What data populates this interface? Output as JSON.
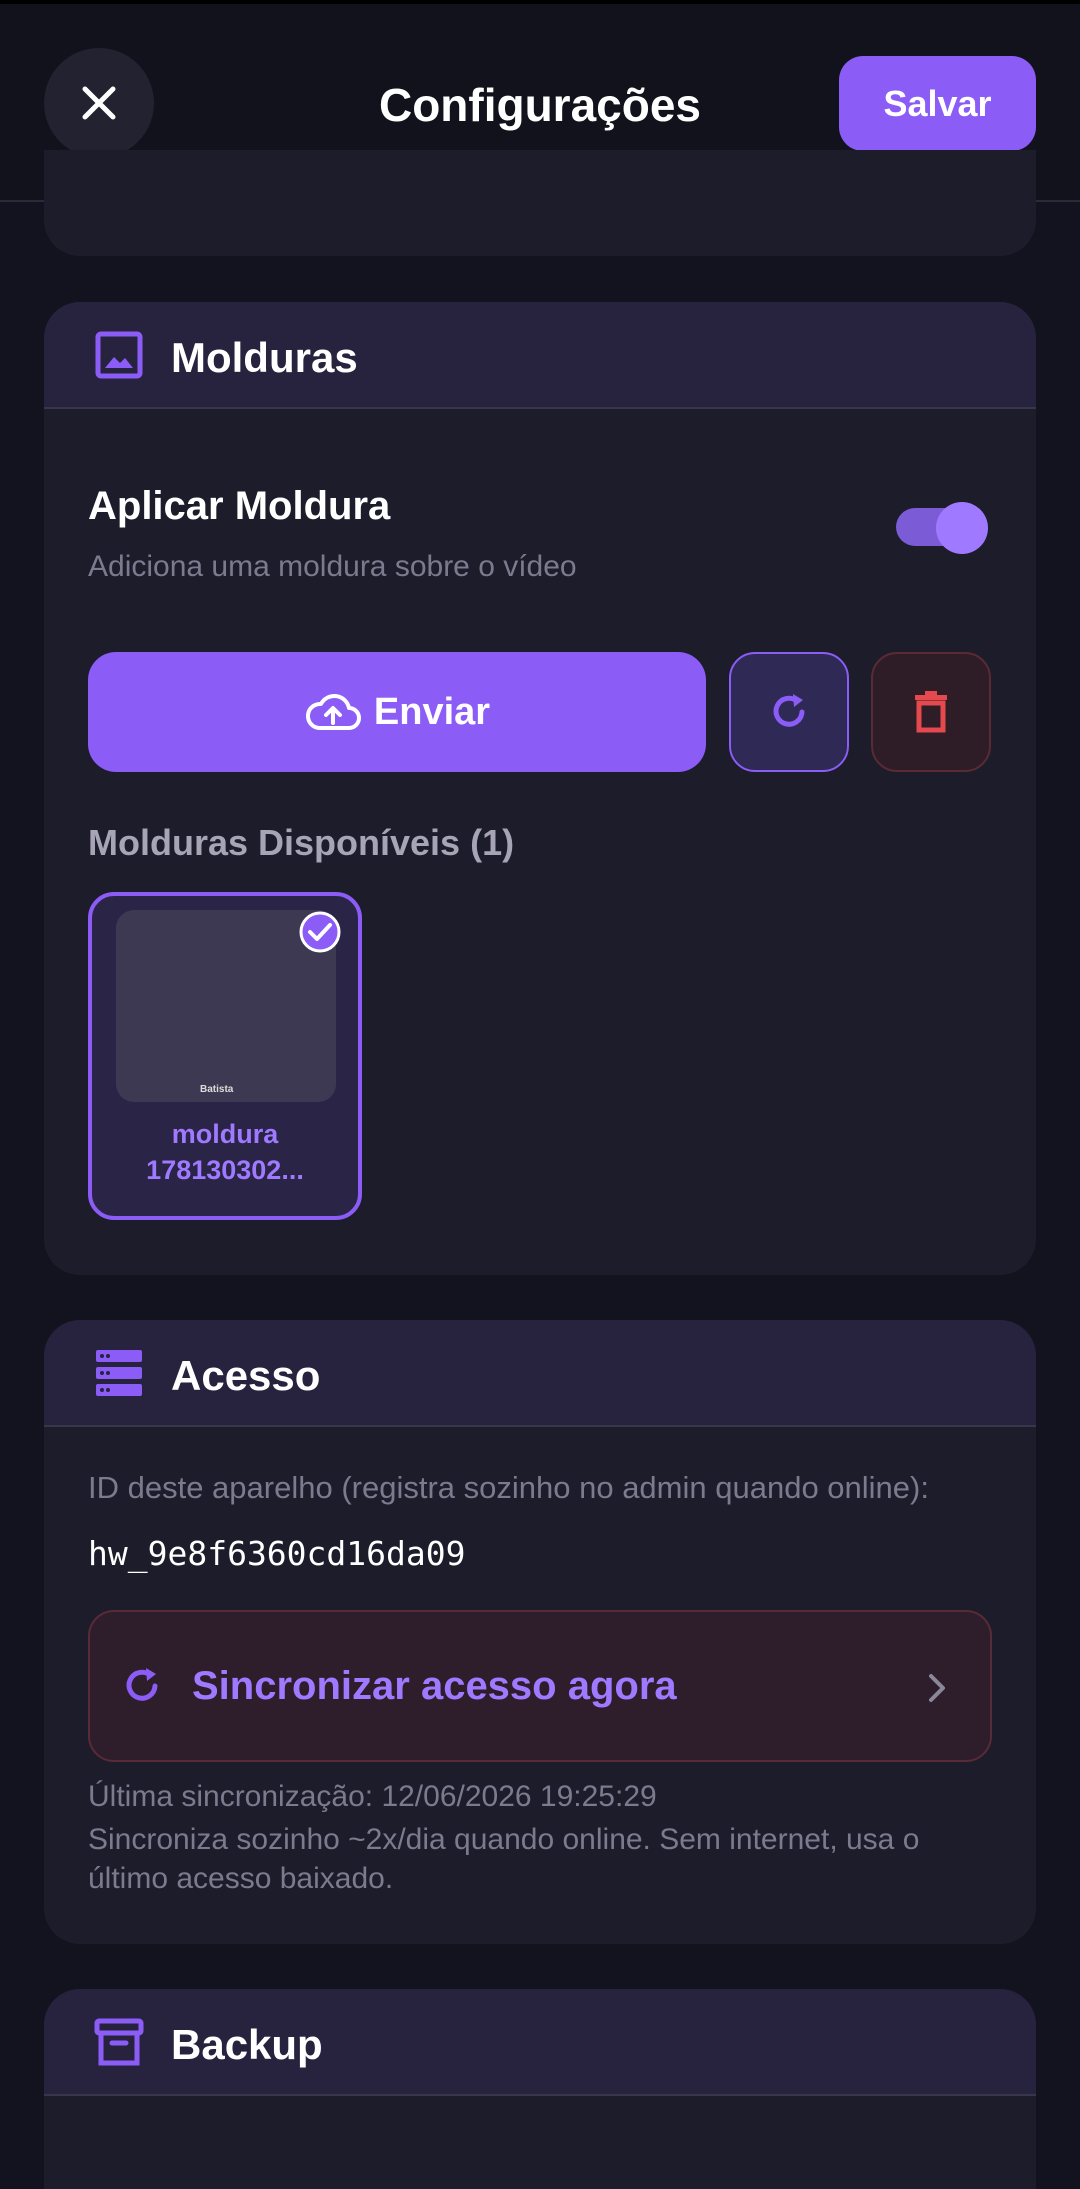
{
  "header": {
    "title": "Configurações",
    "save_label": "Salvar"
  },
  "molduras": {
    "title": "Molduras",
    "apply_title": "Aplicar Moldura",
    "apply_subtitle": "Adiciona uma moldura sobre o vídeo",
    "apply_enabled": true,
    "upload_label": "Enviar",
    "available_label": "Molduras Disponíveis (1)",
    "frames": [
      {
        "name_line1": "moldura",
        "name_line2": "178130302...",
        "selected": true,
        "thumb_text": "Batista"
      }
    ]
  },
  "acesso": {
    "title": "Acesso",
    "id_label": "ID deste aparelho (registra sozinho no admin quando online):",
    "id_value": "hw_9e8f6360cd16da09",
    "sync_label": "Sincronizar acesso agora",
    "last_sync": "Última sincronização: 12/06/2026 19:25:29",
    "sync_note": "Sincroniza sozinho ~2x/dia quando online. Sem internet, usa o último acesso baixado."
  },
  "backup": {
    "title": "Backup"
  },
  "colors": {
    "accent": "#8b5cf6",
    "danger": "#e5484d",
    "background": "#13131f",
    "card": "#1d1c2b"
  },
  "icons": [
    "close-icon",
    "image-icon",
    "cloud-upload-icon",
    "refresh-icon",
    "trash-icon",
    "check-circle-icon",
    "server-icon",
    "sync-icon",
    "chevron-right-icon",
    "archive-icon"
  ]
}
